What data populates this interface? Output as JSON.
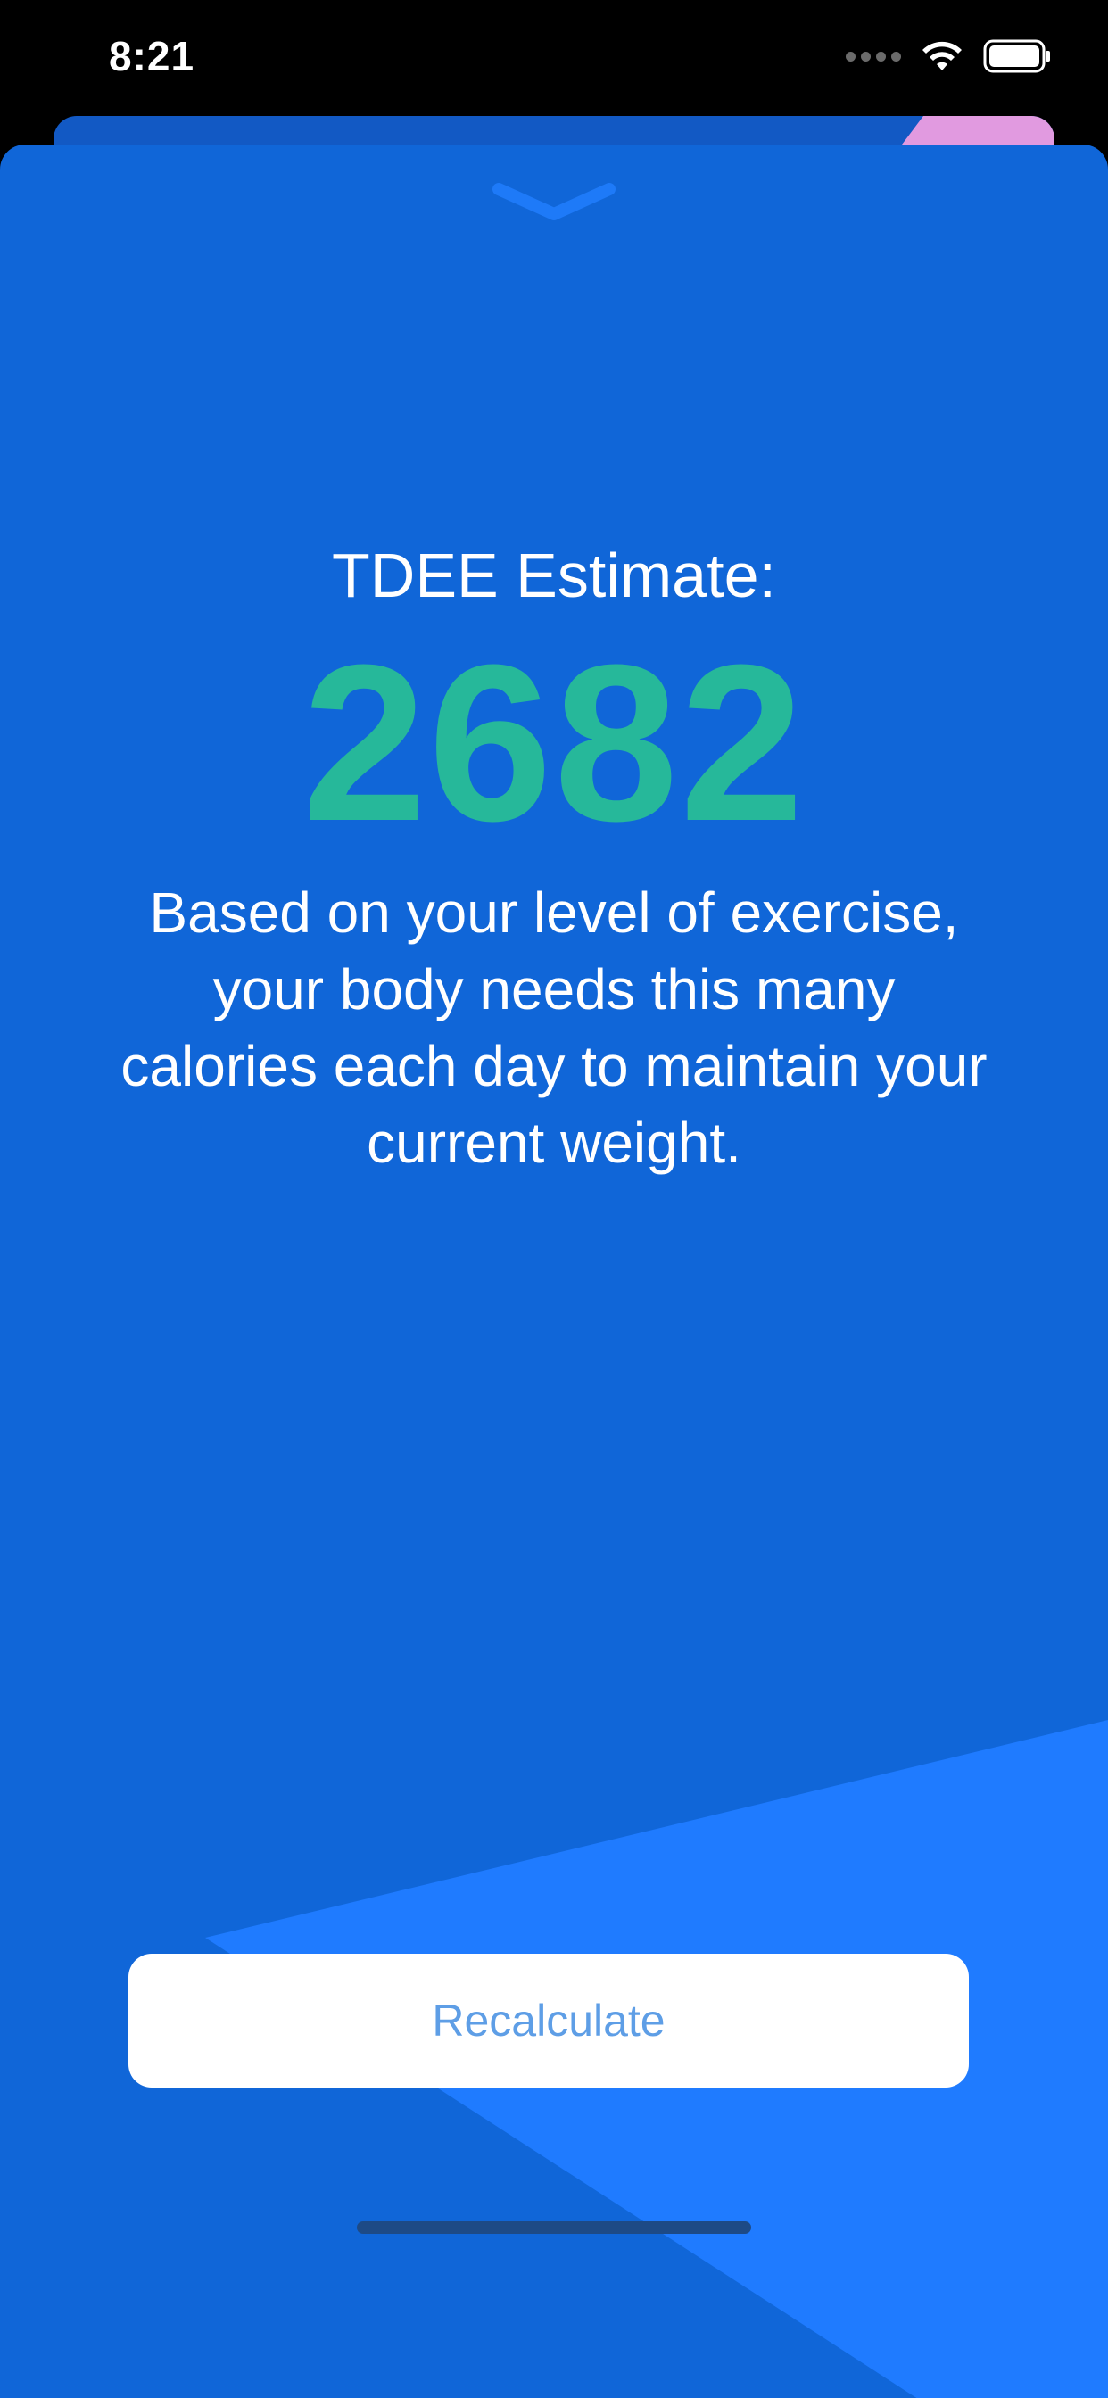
{
  "status_bar": {
    "time": "8:21",
    "signal_icon": "signal-dots-icon",
    "wifi_icon": "wifi-icon",
    "battery_icon": "battery-icon"
  },
  "sheet": {
    "dismiss_icon": "chevron-down-icon",
    "title": "TDEE Estimate:",
    "value": "2682",
    "description": "Based on your level of exercise, your body needs this many calories each day to maintain your current weight.",
    "button_label": "Recalculate"
  },
  "colors": {
    "background": "#000000",
    "sheet": "#1066d8",
    "sheet_shape": "#1f7bff",
    "back_card": "#1259c4",
    "back_card_accent": "#e19ae0",
    "value_text": "#26b89a",
    "button_text": "#5e9ee6"
  }
}
